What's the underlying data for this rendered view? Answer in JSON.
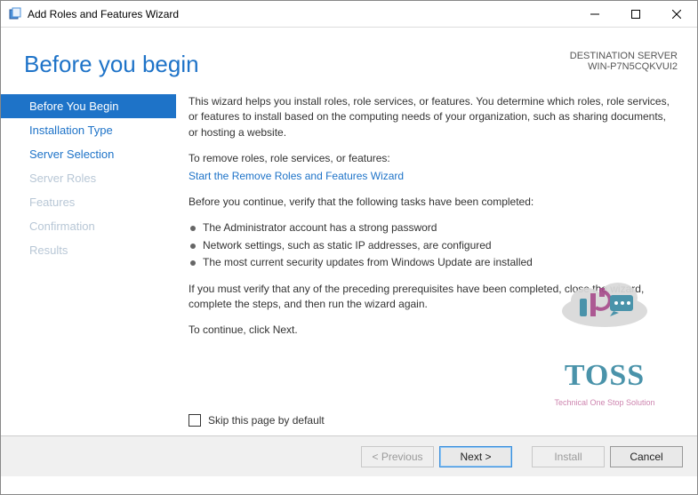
{
  "titlebar": {
    "title": "Add Roles and Features Wizard"
  },
  "header": {
    "page_title": "Before you begin",
    "dest_label": "DESTINATION SERVER",
    "dest_value": "WIN-P7N5CQKVUI2"
  },
  "sidebar": {
    "items": [
      {
        "label": "Before You Begin",
        "state": "active"
      },
      {
        "label": "Installation Type",
        "state": "enabled"
      },
      {
        "label": "Server Selection",
        "state": "enabled"
      },
      {
        "label": "Server Roles",
        "state": "disabled"
      },
      {
        "label": "Features",
        "state": "disabled"
      },
      {
        "label": "Confirmation",
        "state": "disabled"
      },
      {
        "label": "Results",
        "state": "disabled"
      }
    ]
  },
  "content": {
    "intro": "This wizard helps you install roles, role services, or features. You determine which roles, role services, or features to install based on the computing needs of your organization, such as sharing documents, or hosting a website.",
    "remove_label": "To remove roles, role services, or features:",
    "remove_link": "Start the Remove Roles and Features Wizard",
    "verify_intro": "Before you continue, verify that the following tasks have been completed:",
    "bullets": [
      "The Administrator account has a strong password",
      "Network settings, such as static IP addresses, are configured",
      "The most current security updates from Windows Update are installed"
    ],
    "must_verify": "If you must verify that any of the preceding prerequisites have been completed, close the wizard, complete the steps, and then run the wizard again.",
    "continue_text": "To continue, click Next.",
    "skip_label": "Skip this page by default"
  },
  "footer": {
    "previous": "< Previous",
    "next": "Next >",
    "install": "Install",
    "cancel": "Cancel"
  },
  "watermark": {
    "brand": "TOSS",
    "tagline": "Technical One Stop Solution"
  }
}
